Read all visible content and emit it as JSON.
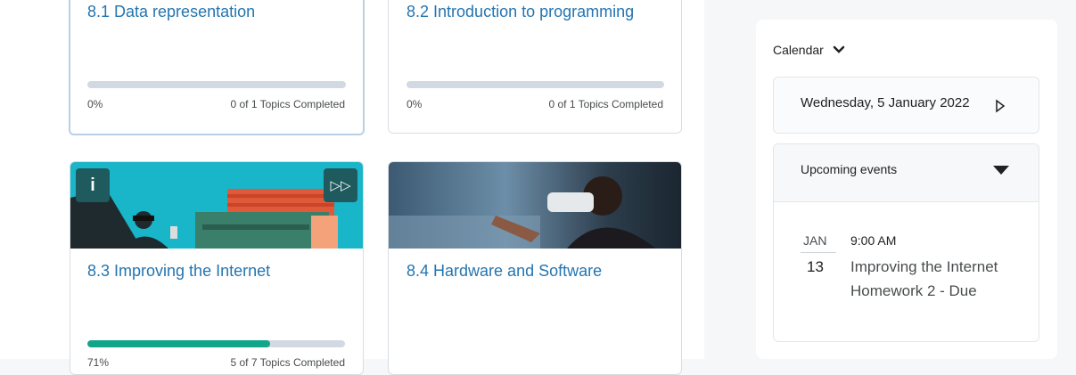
{
  "cards": [
    {
      "title": "8.1 Data representation",
      "progress_percent": 0,
      "percent_label": "0%",
      "topics_label": "0 of 1 Topics Completed"
    },
    {
      "title": "8.2 Introduction to programming",
      "progress_percent": 0,
      "percent_label": "0%",
      "topics_label": "0 of 1 Topics Completed"
    },
    {
      "title": "8.3 Improving the Internet",
      "progress_percent": 71,
      "percent_label": "71%",
      "topics_label": "5 of 7 Topics Completed"
    },
    {
      "title": "8.4 Hardware and Software"
    }
  ],
  "badges": {
    "info": "i",
    "skip": "▷▷"
  },
  "calendar": {
    "header": "Calendar",
    "date": "Wednesday, 5 January 2022",
    "upcoming_title": "Upcoming events",
    "events": [
      {
        "month": "JAN",
        "day": "13",
        "time": "9:00 AM",
        "name": "Improving the Internet Homework 2 - Due"
      }
    ]
  },
  "colors": {
    "accent_link": "#2475b0",
    "progress_fill": "#12a58b",
    "progress_track": "#d3d9e3",
    "badge_bg": "#1f5a5e"
  }
}
